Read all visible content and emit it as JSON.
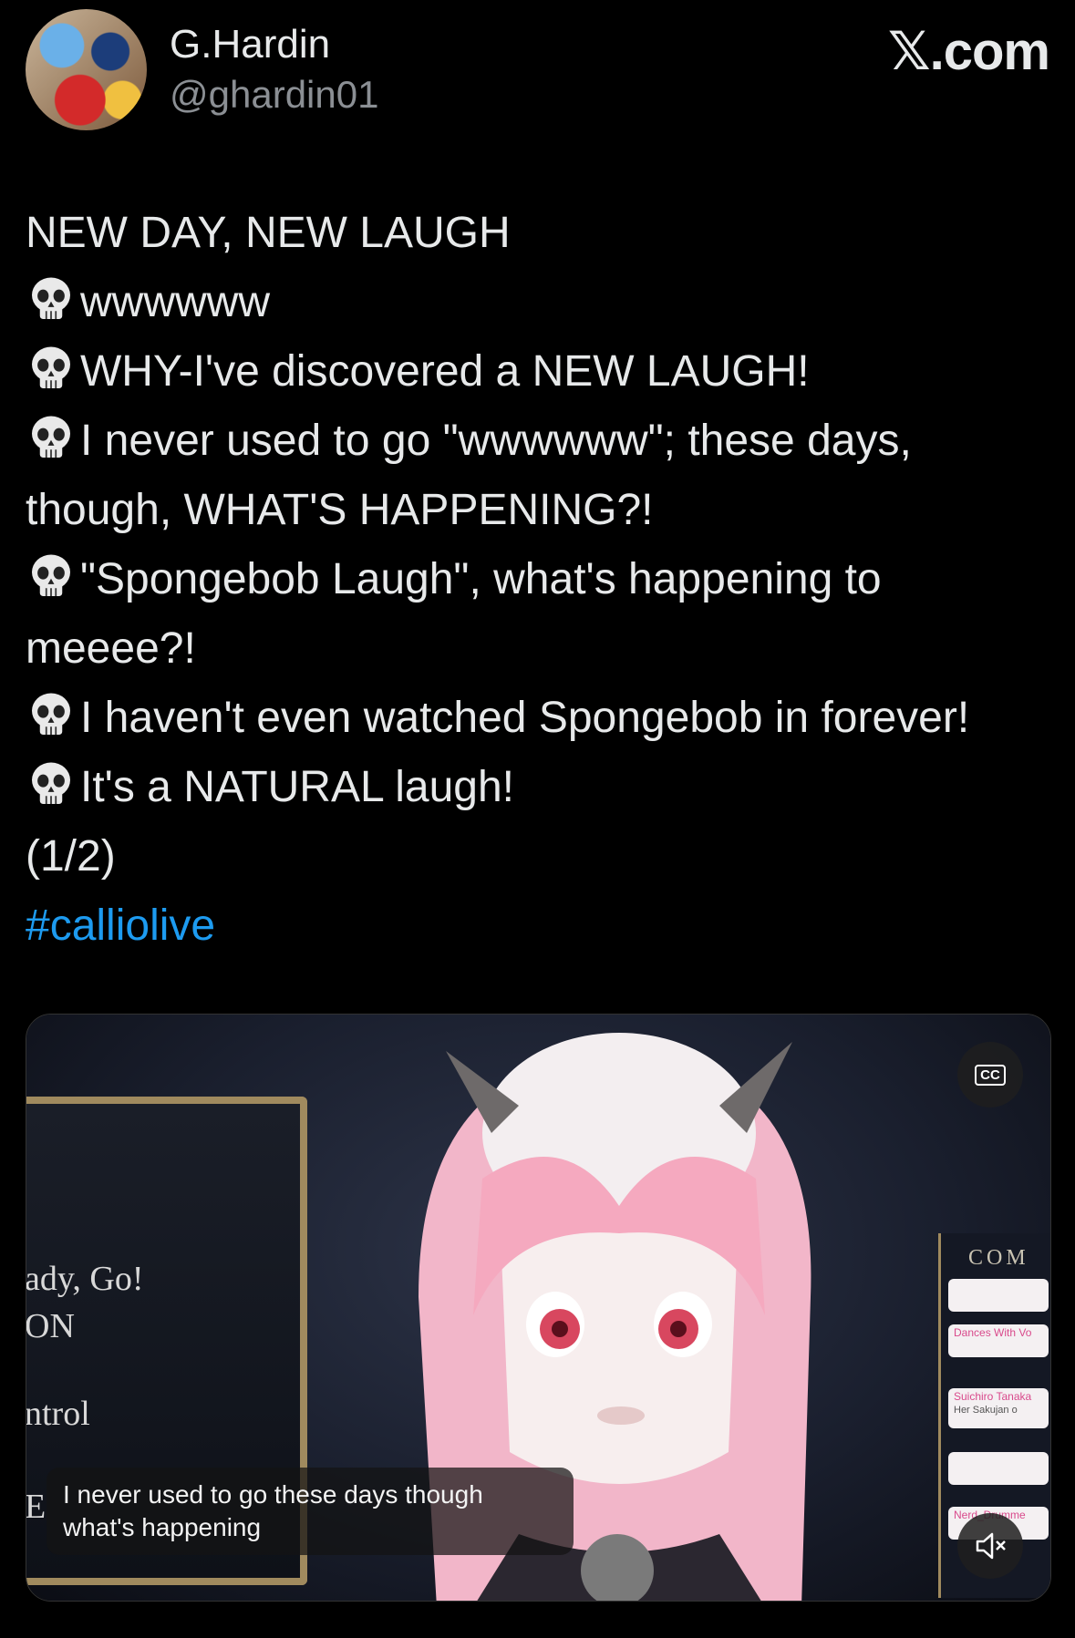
{
  "header": {
    "display_name": "G.Hardin",
    "handle": "@ghardin01",
    "brand": "𝕏.com",
    "avatar_icon": "avatar"
  },
  "post": {
    "line1": "NEW DAY, NEW LAUGH",
    "line2": "wwwwww",
    "line3": "WHY-I've discovered a NEW LAUGH!",
    "line4": "I never used to go \"wwwwww\"; these days,",
    "line5": "though, WHAT'S HAPPENING?!",
    "line6": "\"Spongebob Laugh\", what's happening to",
    "line7": "meeee?!",
    "line8": "I haven't even watched Spongebob in forever!",
    "line9": "It's a NATURAL laugh!",
    "line10": "(1/2)",
    "hashtag": "#calliolive",
    "emoji_icon": "skull-icon"
  },
  "video": {
    "caption_line1": "I never used to go these days though",
    "caption_line2": "what's happening",
    "cc_label": "CC",
    "left_panel_text1": "ady, Go!",
    "left_panel_text2": "ON",
    "left_panel_text3": "ntrol",
    "left_panel_text4": "E",
    "right_panel_title": "COM",
    "chat1_label": "Dances With Vo",
    "chat2_label": "Suichiro Tanaka",
    "chat2_sub": "Her Sakujan o",
    "chat3_label": "Nerd_Drumme",
    "mute_icon": "mute-icon"
  },
  "colors": {
    "background": "#000000",
    "text": "#e7e9ea",
    "muted": "#8b8f94",
    "link": "#1d9bf0"
  }
}
